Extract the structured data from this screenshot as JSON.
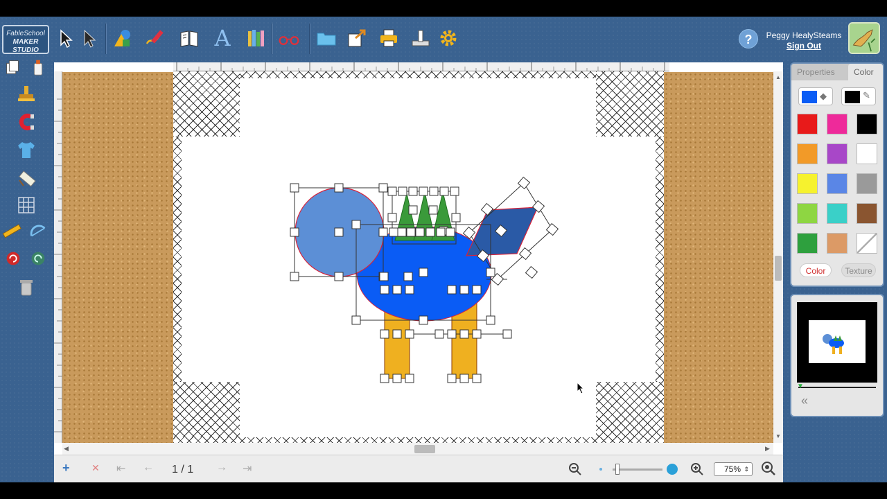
{
  "app": {
    "logo_line1": "FableSchool",
    "logo_line2": "MAKER STUDIO"
  },
  "toolbar": {
    "items": [
      {
        "name": "select-arrow-icon"
      },
      {
        "name": "direct-select-icon"
      },
      {
        "name": "shapes-icon"
      },
      {
        "name": "pencil-icon"
      },
      {
        "name": "book-icon"
      },
      {
        "name": "text-icon",
        "glyph": "A"
      },
      {
        "name": "library-icon"
      },
      {
        "name": "glasses-icon"
      },
      {
        "name": "folder-icon"
      },
      {
        "name": "export-icon"
      },
      {
        "name": "print-icon"
      },
      {
        "name": "publish-icon"
      },
      {
        "name": "settings-gear-icon"
      }
    ]
  },
  "user": {
    "help": "?",
    "name": "Peggy HealySteams",
    "sign_out": "Sign Out"
  },
  "leftbar": {
    "items": [
      "copy-icon",
      "glue-icon",
      "stamp-icon",
      "magnet-icon",
      "shirt-icon",
      "tape-icon",
      "grid-icon",
      "ruler-icon",
      "protractor-icon",
      "undo-icon",
      "redo-icon",
      "trash-icon"
    ]
  },
  "pager": {
    "page_label": "1 / 1",
    "zoom": "75%"
  },
  "panel": {
    "tabs": {
      "properties": "Properties",
      "color": "Color"
    },
    "current_fill": "#0a5cf5",
    "current_stroke": "#000000",
    "swatches": [
      "#e81a1a",
      "#ee2a9a",
      "#000000",
      "#f29a28",
      "#a847c8",
      "#ffffff",
      "#f6f22e",
      "#5a86e6",
      "#9a9a9a",
      "#8ed642",
      "#3ad0c8",
      "#8a5530",
      "#2ea03e",
      "#dc9a66",
      "transparent"
    ],
    "color_btn": "Color",
    "texture_btn": "Texture"
  },
  "drawing": {
    "circle_color": "#5c8fd6",
    "body_color": "#0a5cf5",
    "tree_color": "#3a9a3a",
    "leg_color": "#efb020",
    "diamond_color": "#2a5aa6",
    "outline_color": "#d8223a"
  }
}
